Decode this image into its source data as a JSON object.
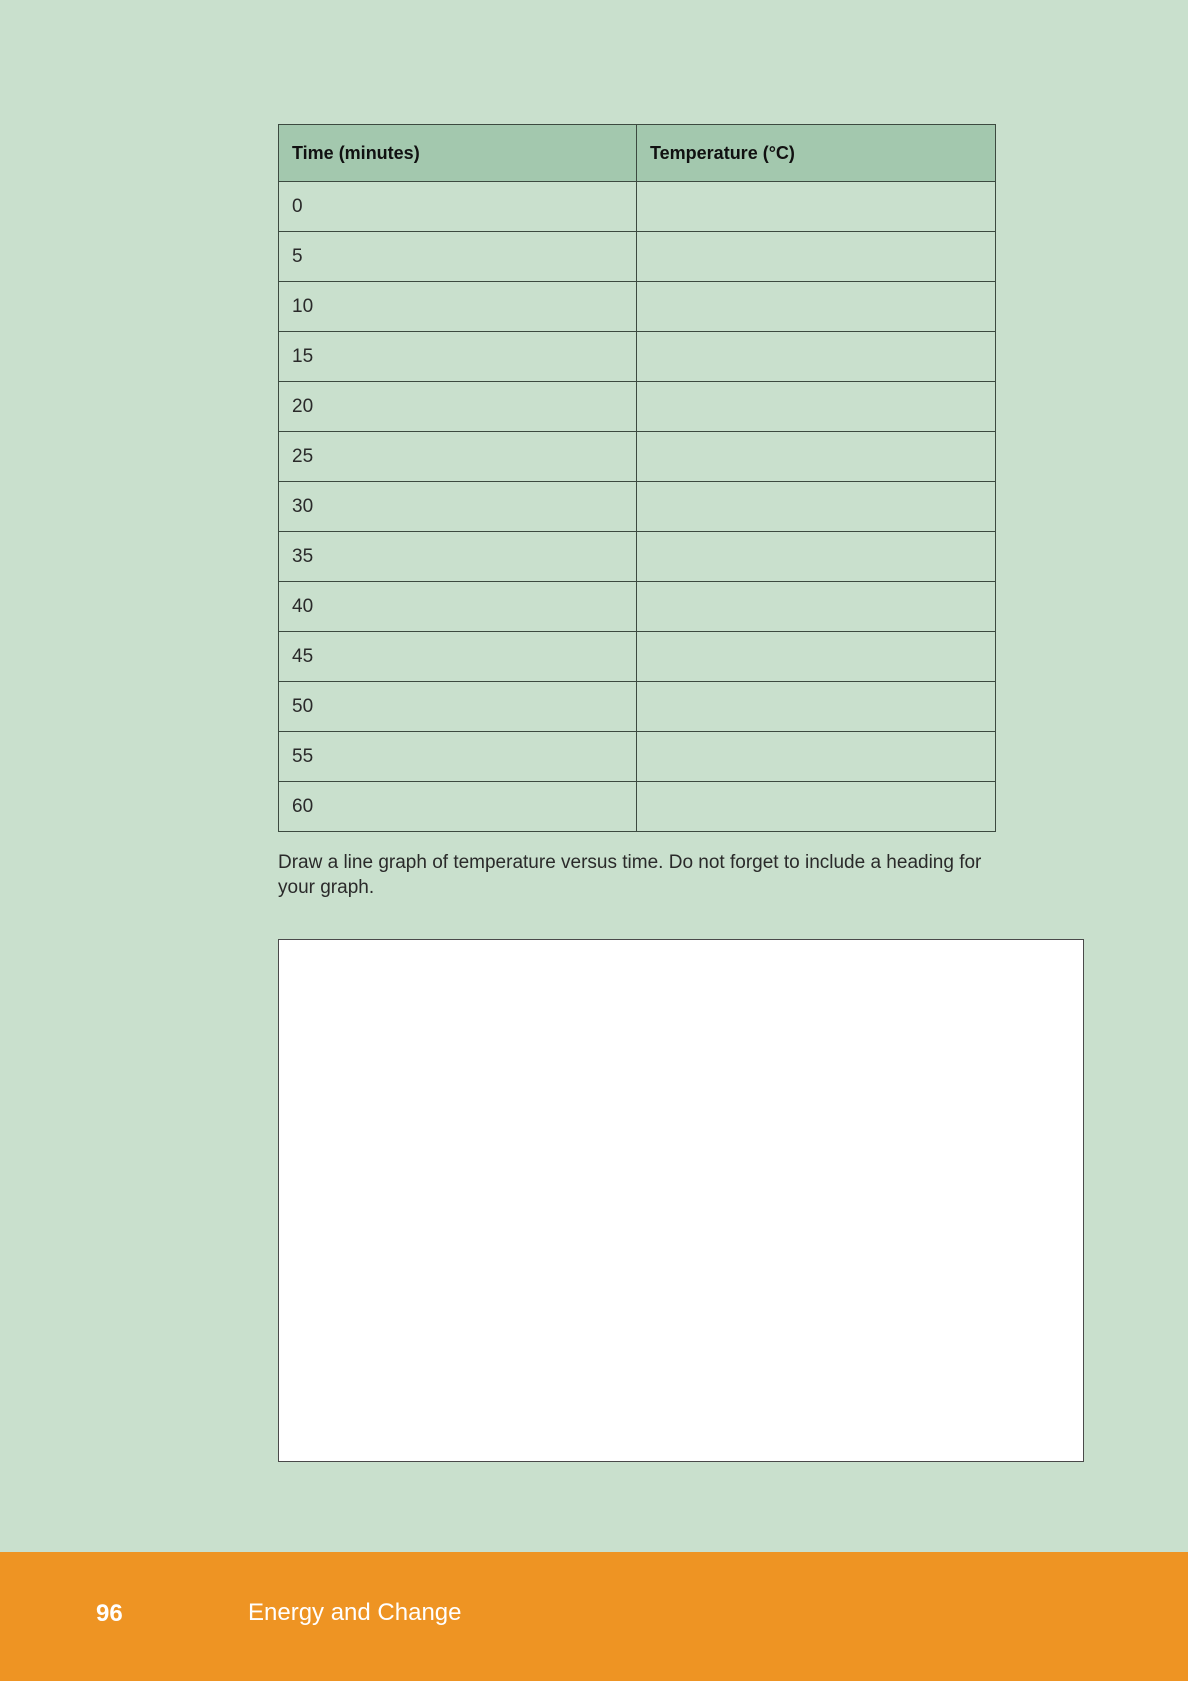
{
  "table": {
    "headers": [
      "Time (minutes)",
      "Temperature (°C)"
    ],
    "rows": [
      {
        "time": "0",
        "temperature": ""
      },
      {
        "time": "5",
        "temperature": ""
      },
      {
        "time": "10",
        "temperature": ""
      },
      {
        "time": "15",
        "temperature": ""
      },
      {
        "time": "20",
        "temperature": ""
      },
      {
        "time": "25",
        "temperature": ""
      },
      {
        "time": "30",
        "temperature": ""
      },
      {
        "time": "35",
        "temperature": ""
      },
      {
        "time": "40",
        "temperature": ""
      },
      {
        "time": "45",
        "temperature": ""
      },
      {
        "time": "50",
        "temperature": ""
      },
      {
        "time": "55",
        "temperature": ""
      },
      {
        "time": "60",
        "temperature": ""
      }
    ]
  },
  "instructions": "Draw a line graph of temperature versus time. Do not forget to include a heading for your graph.",
  "footer": {
    "page_number": "96",
    "title": "Energy and Change"
  },
  "colors": {
    "page_background": "#c9e0cd",
    "table_header": "#a3c8ae",
    "footer_bar": "#ee9423"
  }
}
